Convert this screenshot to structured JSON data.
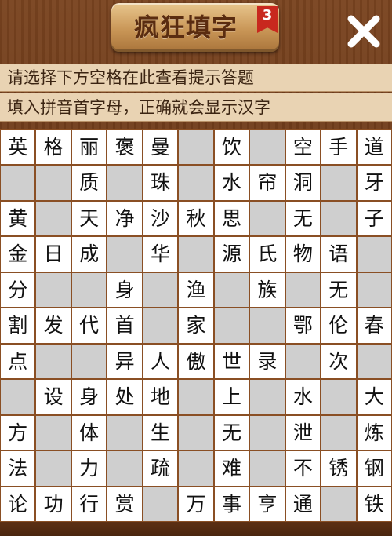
{
  "header": {
    "logo_text": "疯狂填字",
    "level": "3"
  },
  "hints": {
    "line1": "请选择下方空格在此查看提示答题",
    "line2": "填入拼音首字母，正确就会显示汉字"
  },
  "grid": {
    "rows": [
      [
        "英",
        "格",
        "丽",
        "褒",
        "曼",
        "",
        "饮",
        "",
        "空",
        "手",
        "道"
      ],
      [
        "",
        "",
        "质",
        "",
        "珠",
        "",
        "水",
        "帘",
        "洞",
        "",
        "牙"
      ],
      [
        "黄",
        "",
        "天",
        "净",
        "沙",
        "秋",
        "思",
        "",
        "无",
        "",
        "子"
      ],
      [
        "金",
        "日",
        "成",
        "",
        "华",
        "",
        "源",
        "氏",
        "物",
        "语",
        ""
      ],
      [
        "分",
        "",
        "",
        "身",
        "",
        "渔",
        "",
        "族",
        "",
        "无",
        ""
      ],
      [
        "割",
        "发",
        "代",
        "首",
        "",
        "家",
        "",
        "",
        "鄂",
        "伦",
        "春"
      ],
      [
        "点",
        "",
        "",
        "异",
        "人",
        "傲",
        "世",
        "录",
        "",
        "次",
        ""
      ],
      [
        "",
        "设",
        "身",
        "处",
        "地",
        "",
        "上",
        "",
        "水",
        "",
        "大"
      ],
      [
        "方",
        "",
        "体",
        "",
        "生",
        "",
        "无",
        "",
        "泄",
        "",
        "炼"
      ],
      [
        "法",
        "",
        "力",
        "",
        "疏",
        "",
        "难",
        "",
        "不",
        "锈",
        "钢"
      ],
      [
        "论",
        "功",
        "行",
        "赏",
        "",
        "万",
        "事",
        "亨",
        "通",
        "",
        "铁"
      ]
    ]
  }
}
